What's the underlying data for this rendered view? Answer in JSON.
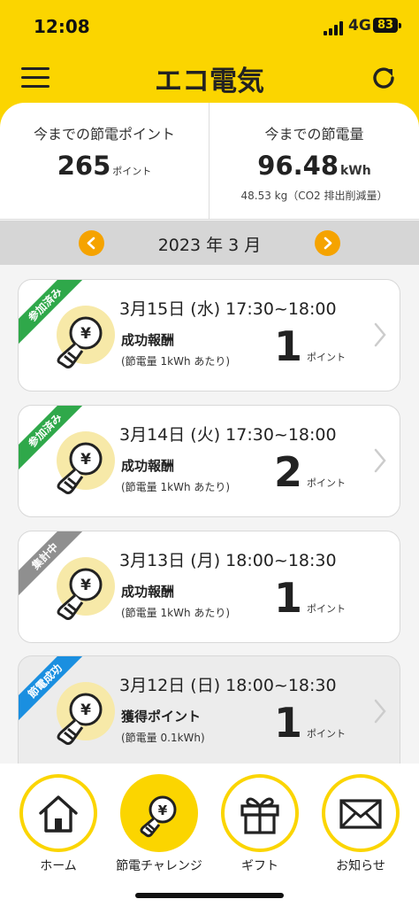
{
  "status": {
    "time": "12:08",
    "network": "4G",
    "battery": "83"
  },
  "header": {
    "title": "エコ電気",
    "menu_icon": "hamburger-icon",
    "refresh_icon": "refresh-icon"
  },
  "summary": {
    "points_label": "今までの節電ポイント",
    "points_value": "265",
    "points_unit": "ポイント",
    "energy_label": "今までの節電量",
    "energy_value": "96.48",
    "energy_unit": "kWh",
    "co2_note": "48.53 kg（CO2 排出削減量）"
  },
  "month_nav": {
    "label": "2023 年 3 月",
    "prev_icon": "chevron-left-icon",
    "next_icon": "chevron-right-icon"
  },
  "colors": {
    "accent": "#fbd500",
    "orange": "#f5a300",
    "green": "#2fa84a",
    "gray": "#8f8f8f",
    "blue": "#1a8fe0"
  },
  "challenges": [
    {
      "badge": "参加済み",
      "badge_color": "#2fa84a",
      "date": "3月15日 (水) 17:30~18:00",
      "reward_label": "成功報酬",
      "note": "(節電量 1kWh あたり)",
      "points": "1",
      "points_unit": "ポイント"
    },
    {
      "badge": "参加済み",
      "badge_color": "#2fa84a",
      "date": "3月14日 (火) 17:30~18:00",
      "reward_label": "成功報酬",
      "note": "(節電量 1kWh あたり)",
      "points": "2",
      "points_unit": "ポイント"
    },
    {
      "badge": "集計中",
      "badge_color": "#8f8f8f",
      "date": "3月13日 (月) 18:00~18:30",
      "reward_label": "成功報酬",
      "note": "(節電量 1kWh あたり)",
      "points": "1",
      "points_unit": "ポイント"
    },
    {
      "badge": "節電成功",
      "badge_color": "#1a8fe0",
      "date": "3月12日 (日) 18:00~18:30",
      "reward_label": "獲得ポイント",
      "note": "(節電量 0.1kWh)",
      "points": "1",
      "points_unit": "ポイント"
    }
  ],
  "tabbar": [
    {
      "label": "ホーム",
      "icon": "home-icon"
    },
    {
      "label": "節電チャレンジ",
      "icon": "bulb-yen-icon"
    },
    {
      "label": "ギフト",
      "icon": "gift-icon"
    },
    {
      "label": "お知らせ",
      "icon": "mail-icon"
    }
  ]
}
